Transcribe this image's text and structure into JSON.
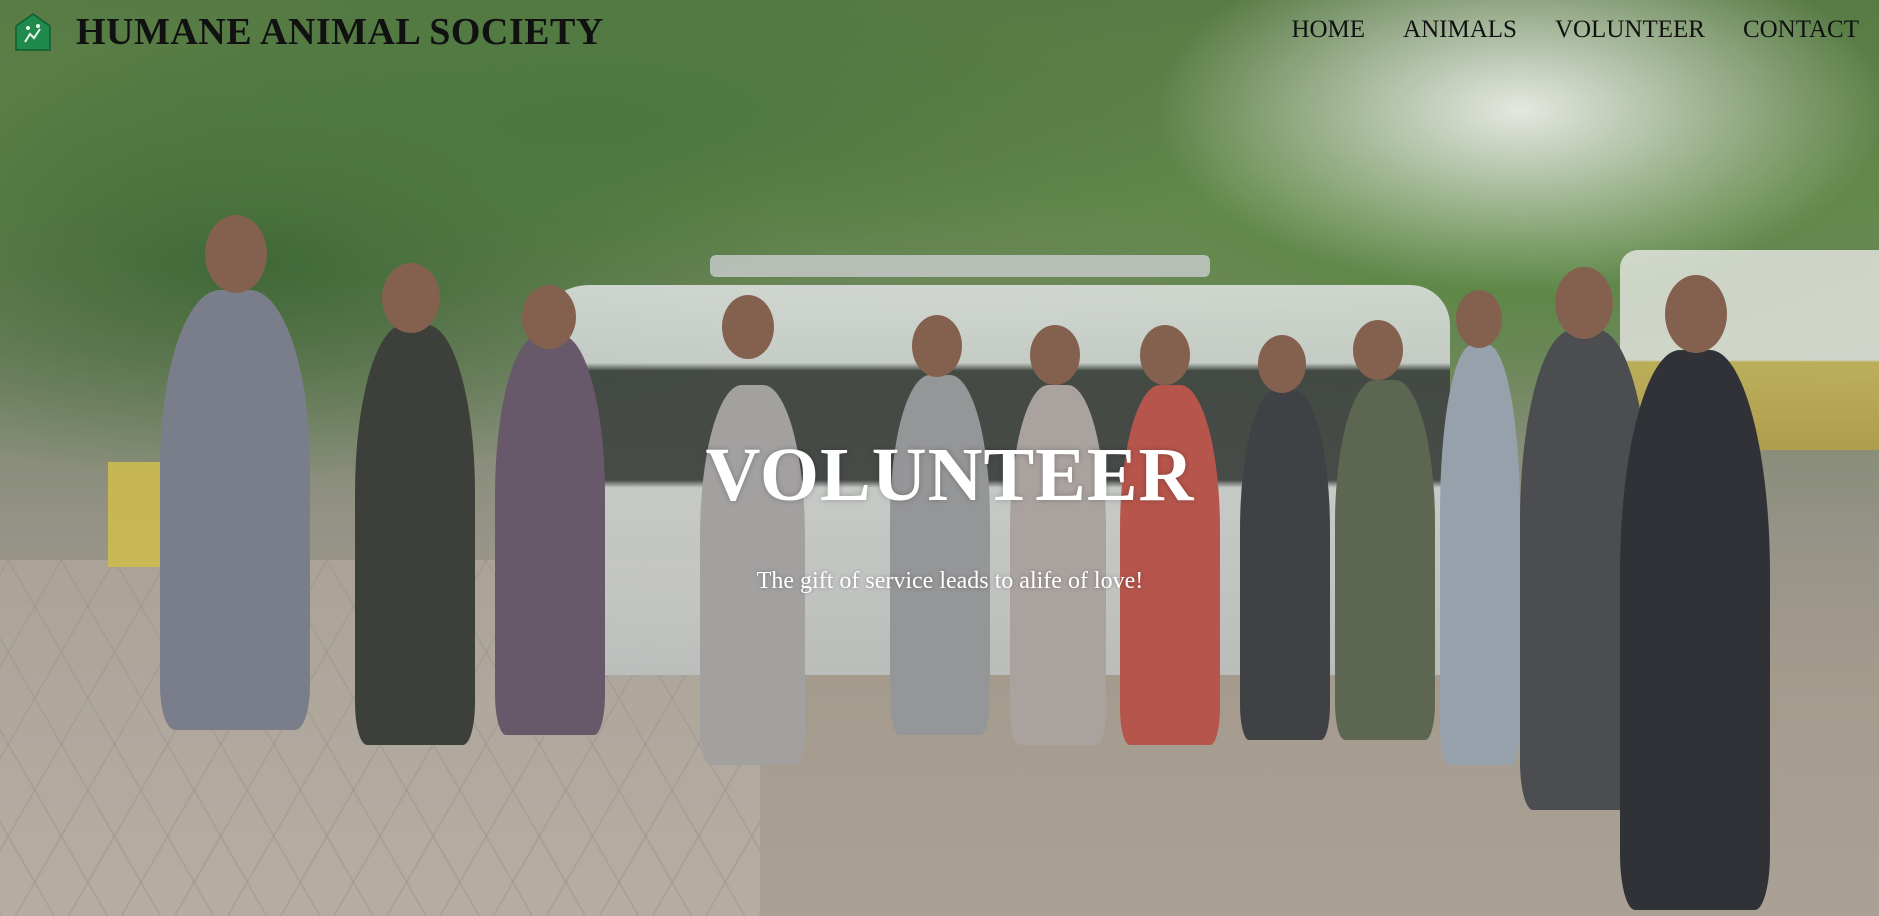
{
  "header": {
    "site_title": "HUMANE ANIMAL SOCIETY",
    "logo_icon": "house-paw-icon",
    "nav": [
      {
        "label": "HOME"
      },
      {
        "label": "ANIMALS"
      },
      {
        "label": "VOLUNTEER"
      },
      {
        "label": "CONTACT"
      }
    ]
  },
  "hero": {
    "title": "VOLUNTEER",
    "subtitle": "The gift of service leads to alife of love!",
    "background_image": "group-of-volunteers-in-front-of-van"
  },
  "colors": {
    "title_text": "#111111",
    "hero_text": "#ffffff",
    "logo_green": "#1f8a4c"
  }
}
